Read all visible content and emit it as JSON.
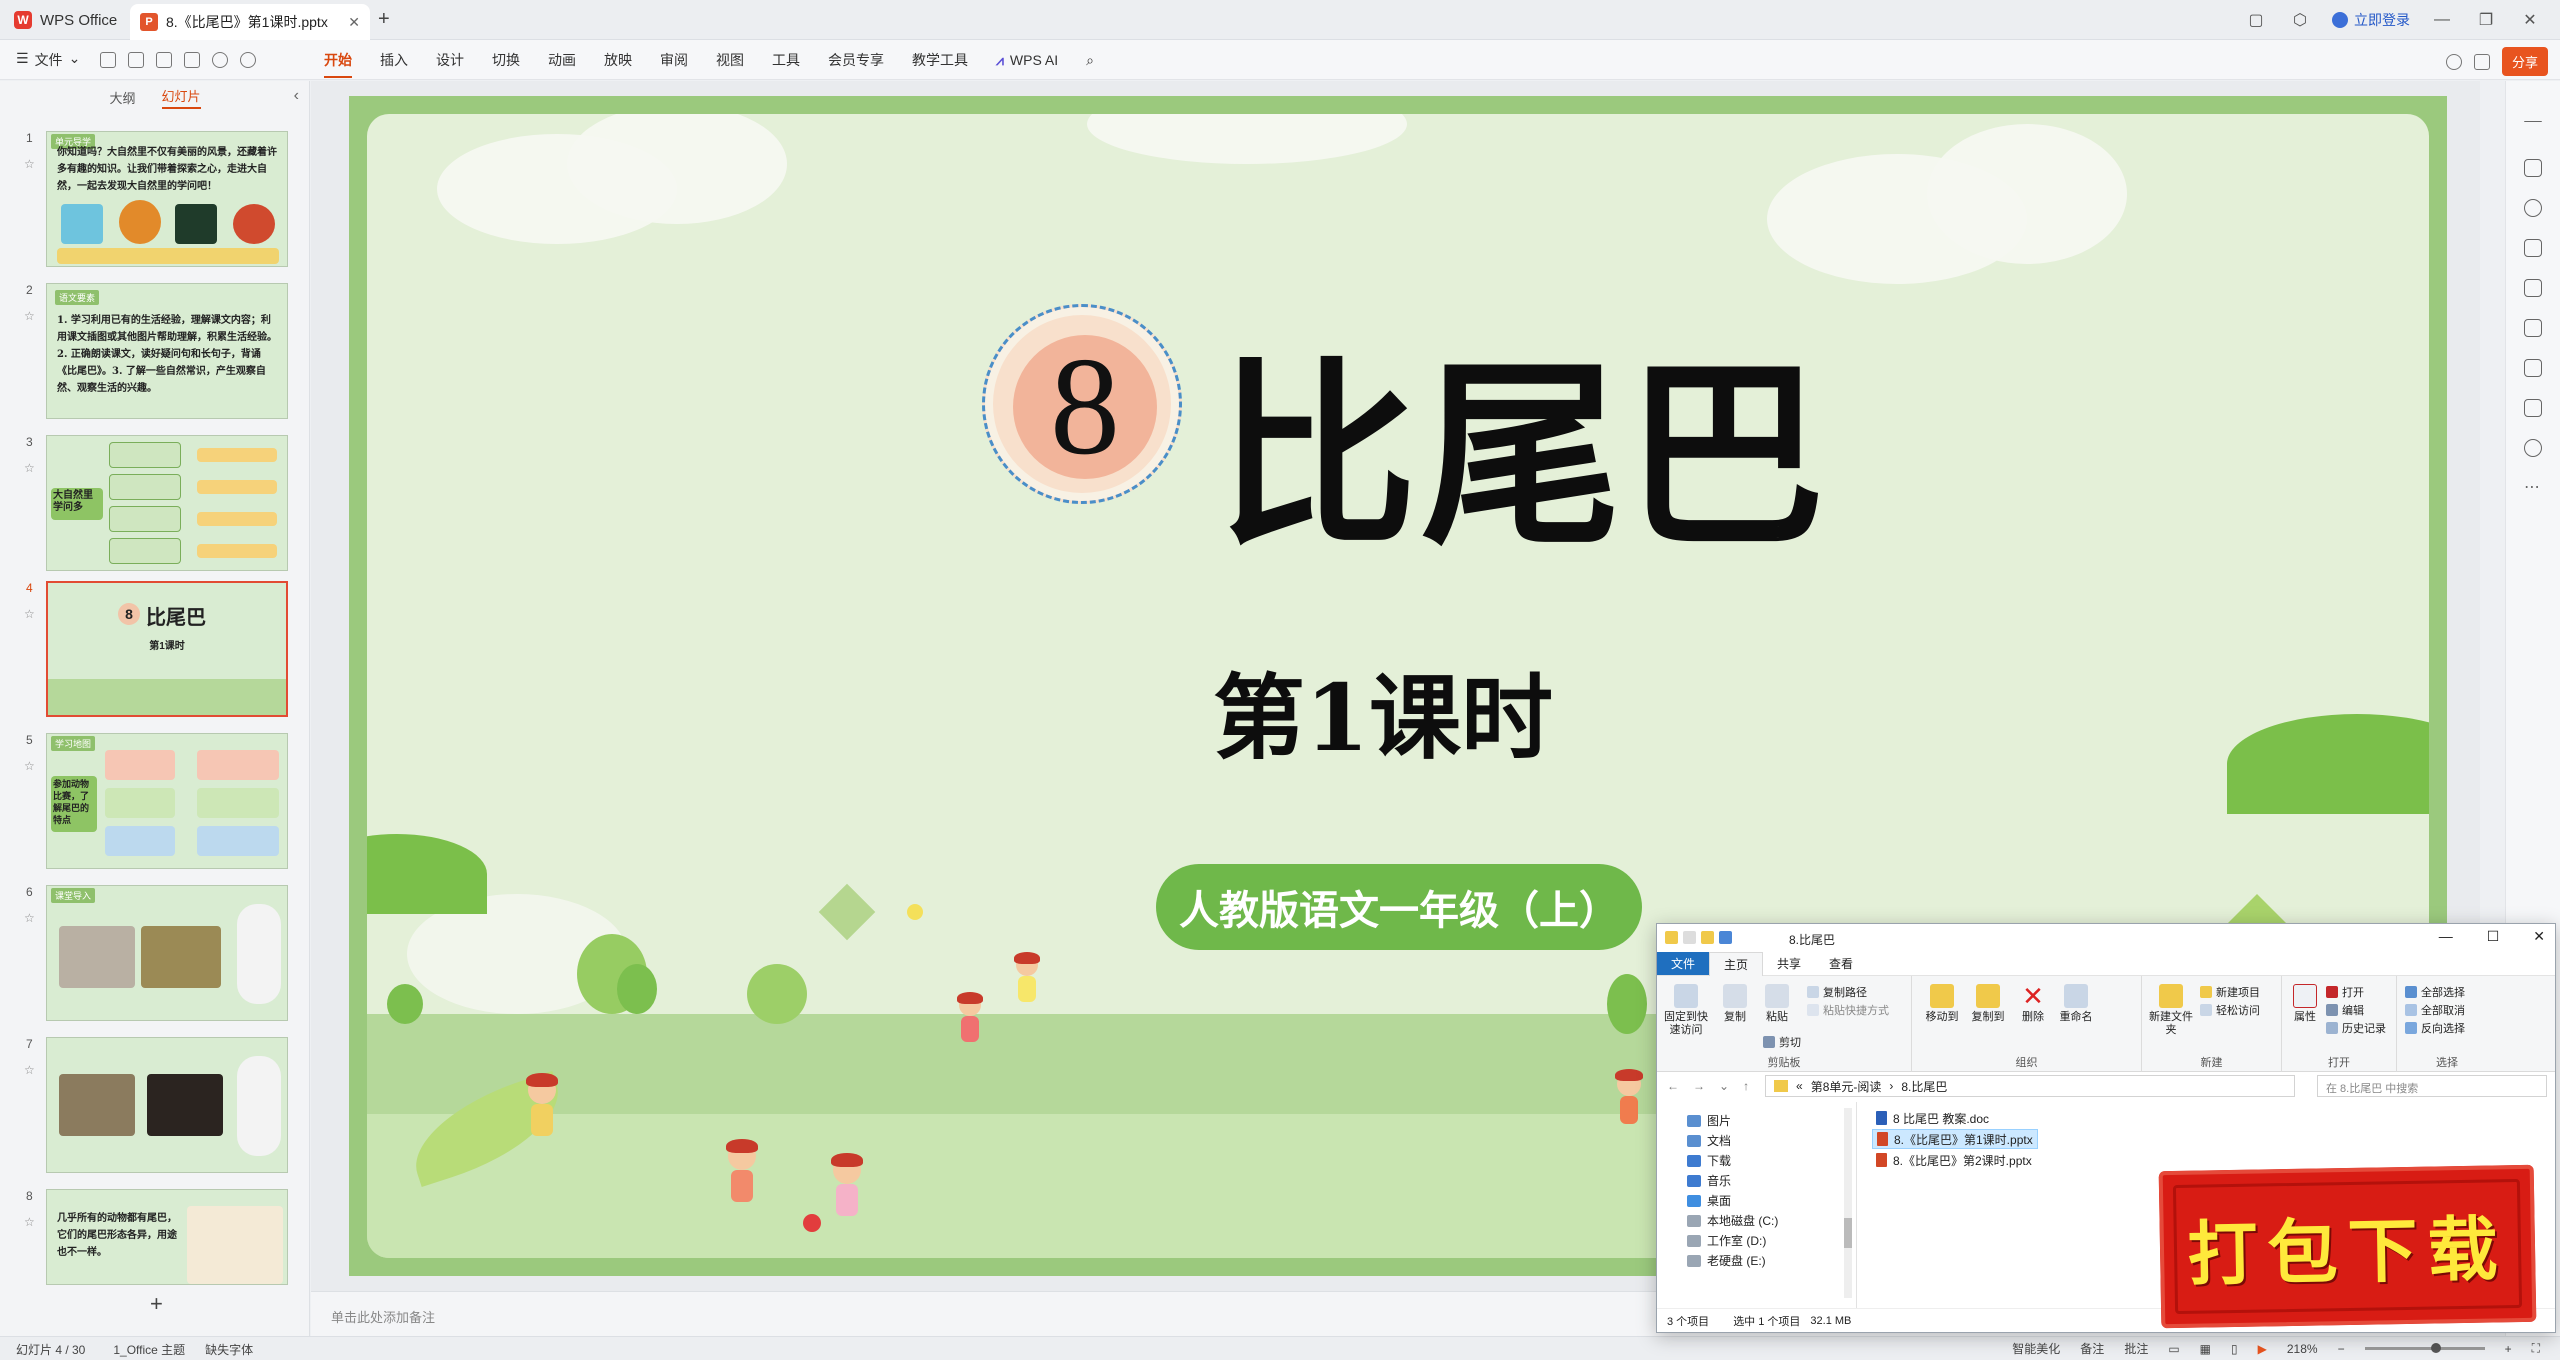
{
  "titlebar": {
    "app_name": "WPS Office",
    "doc_tab": "8.《比尾巴》第1课时.pptx",
    "login": "立即登录"
  },
  "menubar": {
    "file": "文件",
    "tabs": [
      "开始",
      "插入",
      "设计",
      "切换",
      "动画",
      "放映",
      "审阅",
      "视图",
      "工具",
      "会员专享",
      "教学工具"
    ],
    "active_tab": "开始",
    "wps_ai": "WPS AI",
    "share": "分享"
  },
  "leftpanel": {
    "tabs": [
      "大纲",
      "幻灯片"
    ],
    "active_tab": "幻灯片",
    "thumbnails": [
      {
        "num": "1",
        "tag": "单元导学",
        "text": "你知道吗？大自然里不仅有美丽的风景，还藏着许多有趣的知识。让我们带着探索之心，走进大自然，一起去发现大自然里的学问吧！"
      },
      {
        "num": "2",
        "tag": "语文要素",
        "text": "1. 学习利用已有的生活经验，理解课文内容；利用课文插图或其他图片帮助理解，积累生活经验。2. 正确朗读课文，读好疑问句和长句子，背诵《比尾巴》。3. 了解一些自然常识，产生观察自然、观察生活的兴趣。"
      },
      {
        "num": "3",
        "tag": "",
        "text": "大自然里学问多"
      },
      {
        "num": "4",
        "tag": "",
        "text": "比尾巴"
      },
      {
        "num": "5",
        "tag": "学习地图",
        "text": "参加动物比赛，了解尾巴的特点"
      },
      {
        "num": "6",
        "tag": "课堂导入",
        "text": ""
      },
      {
        "num": "7",
        "tag": "",
        "text": ""
      },
      {
        "num": "8",
        "tag": "",
        "text": "几乎所有的动物都有尾巴，它们的尾巴形态各异，用途也不一样。"
      }
    ],
    "selected_index": 3
  },
  "slide": {
    "badge_number": "8",
    "title": "比尾巴",
    "subtitle": "第1课时",
    "pill": "人教版语文一年级（上）"
  },
  "notes_placeholder": "单击此处添加备注",
  "statusbar": {
    "slide_info": "幻灯片 4 / 30",
    "theme": "1_Office 主题",
    "missing_font": "缺失字体",
    "smart": "智能美化",
    "notes": "备注",
    "comments": "批注",
    "zoom": "218%",
    "zoom_fraction": 0.6
  },
  "explorer": {
    "title": "8.比尾巴",
    "ribbon_tabs": [
      "文件",
      "主页",
      "共享",
      "查看"
    ],
    "active_ribbon_tab": "主页",
    "groups": {
      "clipboard": {
        "label": "剪贴板",
        "pin": "固定到快速访问",
        "copy": "复制",
        "paste": "粘贴",
        "copy_path": "复制路径",
        "paste_shortcut": "粘贴快捷方式",
        "cut": "剪切"
      },
      "organize": {
        "label": "组织",
        "move_to": "移动到",
        "copy_to": "复制到",
        "delete": "删除",
        "rename": "重命名"
      },
      "new": {
        "label": "新建",
        "new_folder": "新建文件夹",
        "new_item": "新建项目",
        "easy_access": "轻松访问"
      },
      "open": {
        "label": "打开",
        "properties": "属性",
        "open": "打开",
        "edit": "编辑",
        "history": "历史记录"
      },
      "select": {
        "label": "选择",
        "select_all": "全部选择",
        "select_none": "全部取消",
        "invert": "反向选择"
      }
    },
    "path": [
      "第8单元-阅读",
      "8.比尾巴"
    ],
    "search_placeholder": "在 8.比尾巴 中搜索",
    "tree": [
      "图片",
      "文档",
      "下载",
      "音乐",
      "桌面",
      "本地磁盘 (C:)",
      "工作室 (D:)",
      "老硬盘 (E:)"
    ],
    "files": [
      {
        "name": "8 比尾巴 教案.doc",
        "type": "doc"
      },
      {
        "name": "8.《比尾巴》第1课时.pptx",
        "type": "ppt",
        "selected": true
      },
      {
        "name": "8.《比尾巴》第2课时.pptx",
        "type": "ppt"
      }
    ],
    "status": [
      "3 个项目",
      "选中 1 个项目",
      "32.1 MB"
    ]
  },
  "stamp": {
    "text": "打包下载"
  },
  "colors": {
    "accent": "#d9480f",
    "slide_green": "#9bc97d",
    "pill_green": "#6fb84a",
    "stamp_red": "#d81c14"
  }
}
